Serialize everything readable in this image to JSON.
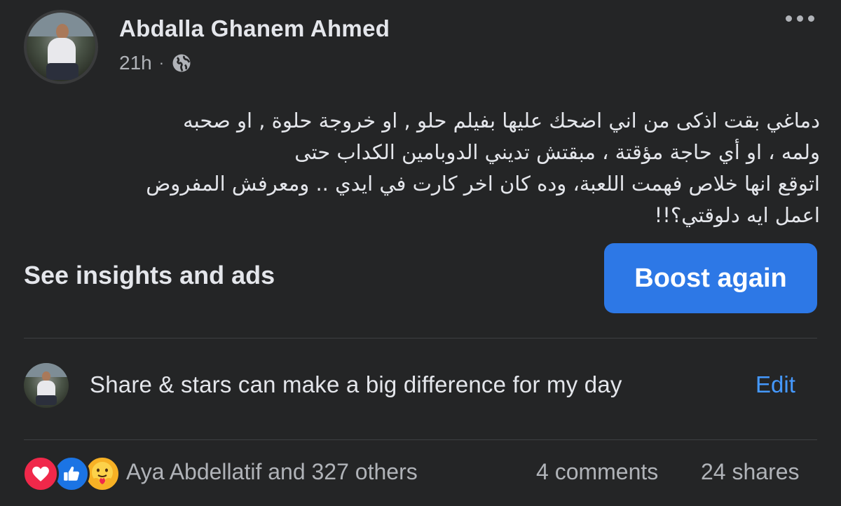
{
  "post": {
    "author": "Abdalla Ghanem Ahmed",
    "time": "21h",
    "separator": "·",
    "privacy_icon": "globe-icon",
    "text": "دماغي بقت اذكى من اني اضحك عليها بفيلم حلو , او خروجة حلوة , او صحبه\nولمه ، او أي حاجة مؤقتة ، مبقتش تديني الدوبامين الكداب حتى\nاتوقع انها خلاص فهمت اللعبة، وده كان اخر كارت في ايدي .. ومعرفش المفروض\nاعمل ايه دلوقتي؟!!"
  },
  "actions": {
    "insights_label": "See insights and ads",
    "boost_label": "Boost again",
    "boost_color": "#2d78e6"
  },
  "caption": {
    "text": "Share & stars can make a big difference for my day",
    "edit_label": "Edit",
    "edit_color": "#4599ff"
  },
  "footer": {
    "reaction_icons": [
      "love-reaction-icon",
      "like-reaction-icon",
      "care-reaction-icon"
    ],
    "liked_by": "Aya Abdellatif and 327 others",
    "comments": "4 comments",
    "shares": "24 shares"
  }
}
